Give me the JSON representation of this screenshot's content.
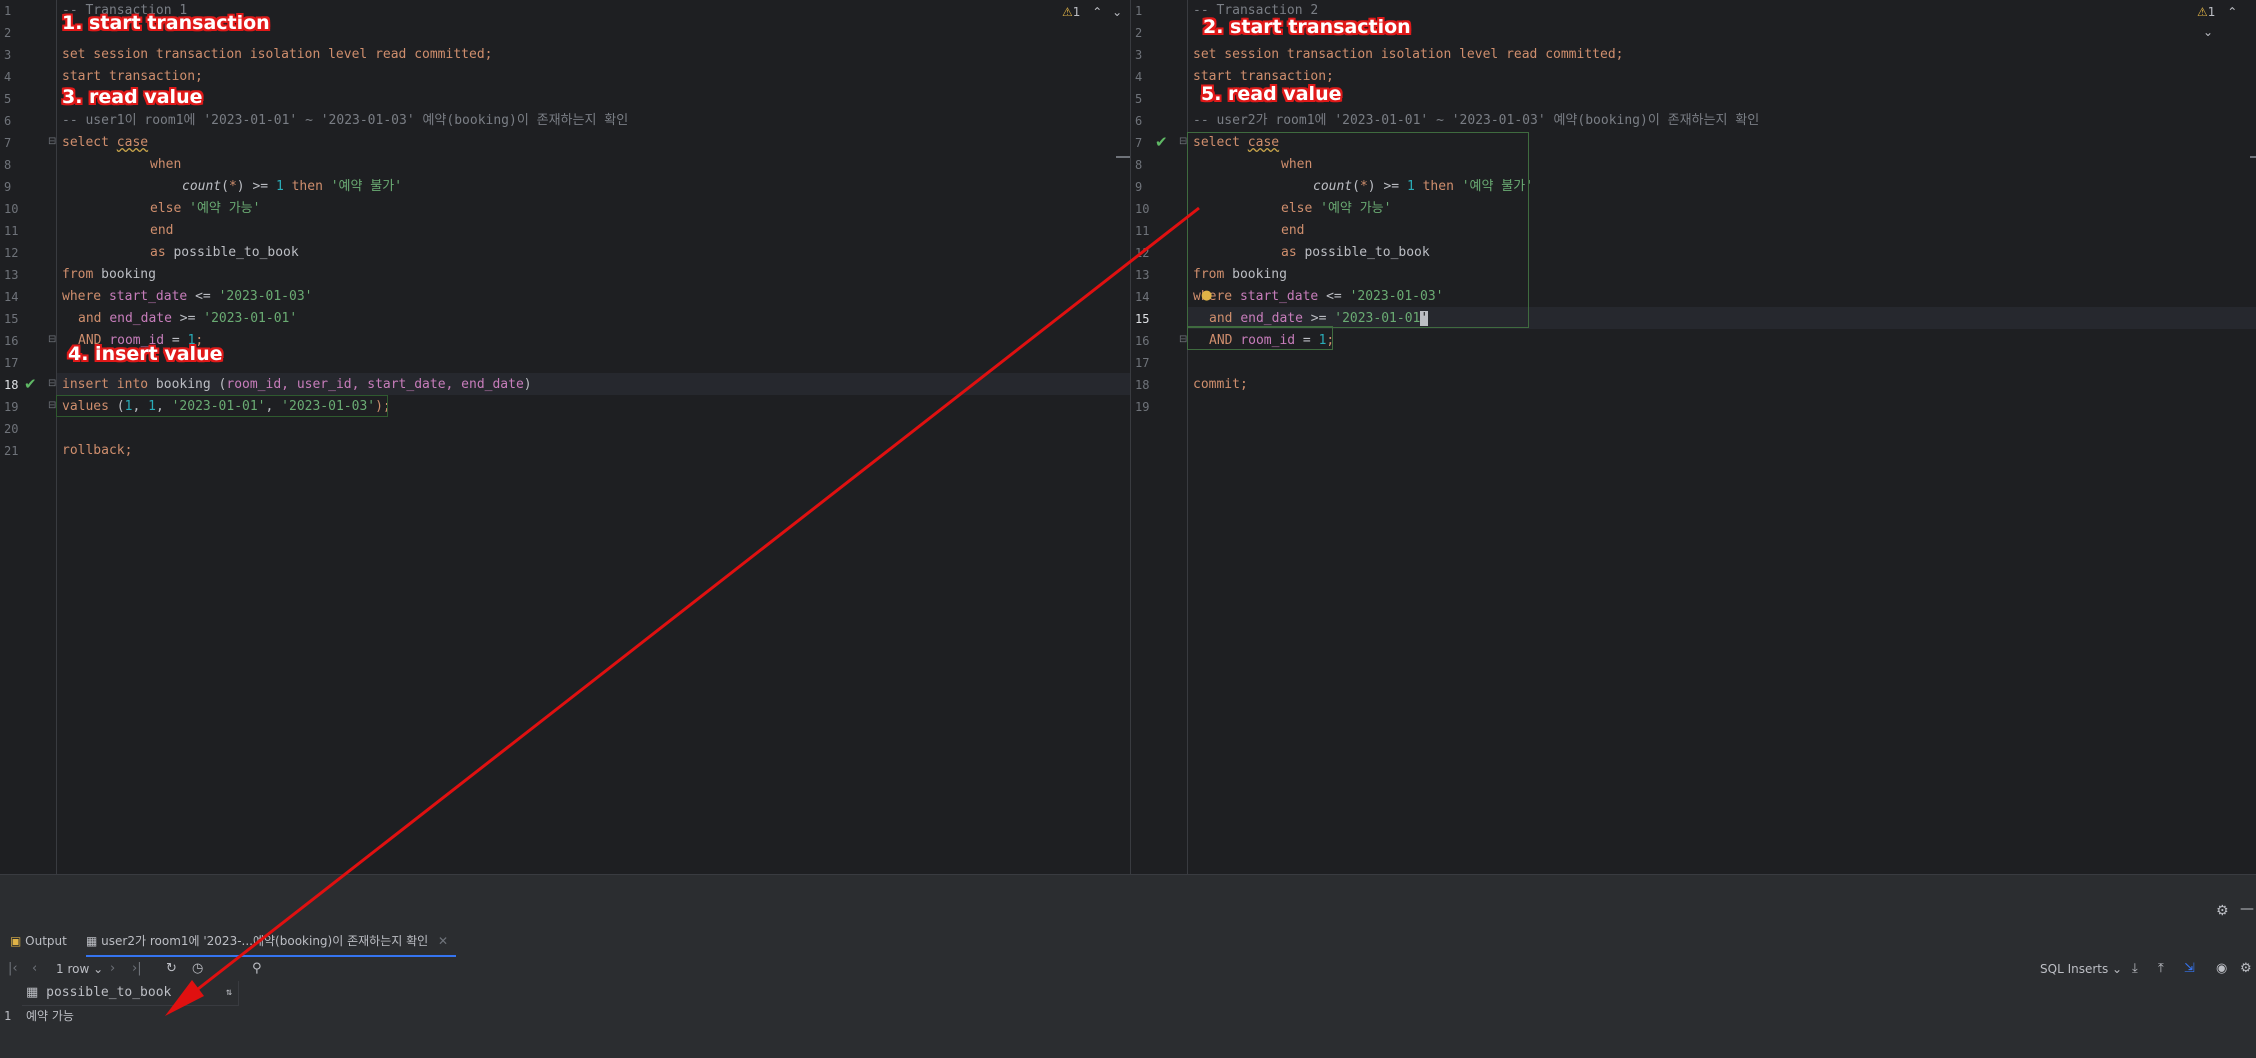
{
  "left_editor": {
    "line_numbers": [
      "1",
      "2",
      "3",
      "4",
      "5",
      "6",
      "7",
      "8",
      "9",
      "10",
      "11",
      "12",
      "13",
      "14",
      "15",
      "16",
      "17",
      "18",
      "19",
      "20",
      "21"
    ],
    "current_line": "18",
    "inspection_count": "1",
    "annotations": [
      "1. start transaction",
      "3. read value",
      "4. insert value"
    ],
    "lines": {
      "l1": "-- Transaction 1",
      "l3a": "set session transaction isolation level read committed;",
      "l4": "start transaction;",
      "l6a": "-- user1이 room1에 '2023-01-01' ~ '2023-01-03' 예약(booking)이 존재하는지 확인",
      "l7a": "select ",
      "l7b": "case",
      "l8": "when",
      "l9a": "count",
      "l9b": "(",
      "l9c": "*",
      "l9d": ") >= ",
      "l9e": "1",
      "l9f": " then ",
      "l9g": "'예약 불가'",
      "l10a": "else ",
      "l10b": "'예약 가능'",
      "l11": "end",
      "l12a": "as ",
      "l12b": "possible_to_book",
      "l13a": "from ",
      "l13b": "booking",
      "l14a": "where ",
      "l14b": "start_date",
      "l14c": " <= ",
      "l14d": "'2023-01-03'",
      "l15a": "and ",
      "l15b": "end_date",
      "l15c": " >= ",
      "l15d": "'2023-01-01'",
      "l16a": "AND ",
      "l16b": "room_id",
      "l16c": " = ",
      "l16d": "1",
      "l16e": ";",
      "l18a": "insert into ",
      "l18b": "booking",
      "l18c": " (",
      "l18d": "room_id, user_id, start_date, end_date",
      "l18e": ")",
      "l19a": "values ",
      "l19b": "(",
      "l19c": "1",
      "l19d": ", ",
      "l19e": "1",
      "l19f": ", ",
      "l19g": "'2023-01-01'",
      "l19h": ", ",
      "l19i": "'2023-01-03'",
      "l19j": ");",
      "l21": "rollback;"
    }
  },
  "right_editor": {
    "line_numbers": [
      "1",
      "2",
      "3",
      "4",
      "5",
      "6",
      "7",
      "8",
      "9",
      "10",
      "11",
      "12",
      "13",
      "14",
      "15",
      "16",
      "17",
      "18",
      "19"
    ],
    "current_line": "15",
    "inspection_count": "1",
    "annotations": [
      "2. start transaction",
      "5. read value"
    ],
    "lines": {
      "l1": "-- Transaction 2",
      "l3a": "set session transaction isolation level read committed;",
      "l4": "start transaction;",
      "l6a": "-- user2가 room1에 '2023-01-01' ~ '2023-01-03' 예약(booking)이 존재하는지 확인",
      "l15d": "'2023-01-01",
      "l15e": "'",
      "l18": "commit;"
    }
  },
  "bottom_panel": {
    "tabs": [
      "Output",
      "user2가 room1에 '2023-...예약(booking)이 존재하는지 확인"
    ],
    "row_count": "1 row",
    "format": "SQL Inserts",
    "result": {
      "columns": [
        "possible_to_book"
      ],
      "rows": [
        [
          "예약 가능"
        ]
      ],
      "row_numbers": [
        "1"
      ]
    }
  },
  "colors": {
    "keyword": "#cf8e6d",
    "string": "#6aab73",
    "number": "#2aacb8",
    "column": "#c77dbb",
    "comment": "#7a7e85",
    "annotation": "#e01919",
    "arrow": "#e01010"
  },
  "icons": [
    "check-icon",
    "warning-icon",
    "chevron-up-icon",
    "chevron-down-icon",
    "fold-icon",
    "output-icon",
    "table-icon",
    "close-icon",
    "refresh-icon",
    "history-icon",
    "pin-icon",
    "export-icon",
    "settings-icon",
    "eye-icon",
    "bulb-icon"
  ]
}
